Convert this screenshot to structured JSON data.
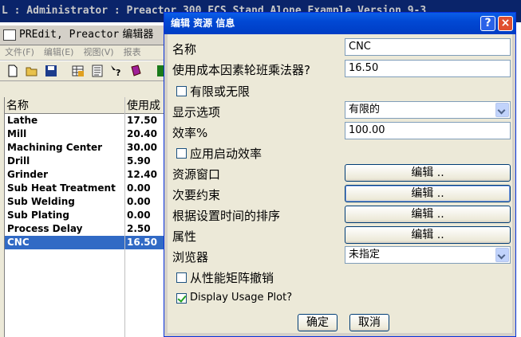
{
  "app_title": "L : Administrator : Preactor 300 FCS Stand Alone Example Version 9-3",
  "child_window": {
    "title_prefix": "PREdit, Preactor",
    "title_suffix": "编辑器"
  },
  "menu": [
    "文件(F)",
    "编辑(E)",
    "视图(V)",
    "报表"
  ],
  "grid": {
    "headers": [
      "名称",
      "使用成"
    ],
    "rows": [
      {
        "name": "Lathe",
        "value": "17.50"
      },
      {
        "name": "Mill",
        "value": "20.40"
      },
      {
        "name": "Machining Center",
        "value": "30.00"
      },
      {
        "name": "Drill",
        "value": "5.90"
      },
      {
        "name": "Grinder",
        "value": "12.40"
      },
      {
        "name": "Sub Heat Treatment",
        "value": "0.00"
      },
      {
        "name": "Sub Welding",
        "value": "0.00"
      },
      {
        "name": "Sub Plating",
        "value": "0.00"
      },
      {
        "name": "Process Delay",
        "value": "2.50"
      },
      {
        "name": "CNC",
        "value": "16.50"
      }
    ],
    "selected_index": 9
  },
  "dialog": {
    "title": "编辑 资源 信息",
    "help": "?",
    "close": "×",
    "name_label": "名称",
    "name_value": "CNC",
    "cost_label": "使用成本因素轮班乘法器?",
    "cost_value": "16.50",
    "finite_label": "有限或无限",
    "finite_checked": false,
    "display_label": "显示选项",
    "display_value": "有限的",
    "efficiency_label": "效率%",
    "efficiency_value": "100.00",
    "startup_label": "应用启动效率",
    "startup_checked": false,
    "resource_window_label": "资源窗口",
    "secondary_label": "次要约束",
    "sequence_label": "根据设置时间的排序",
    "attribute_label": "属性",
    "edit_button": "编辑 ..",
    "browser_label": "浏览器",
    "browser_value": "未指定",
    "matrix_label": "从性能矩阵撤销",
    "matrix_checked": false,
    "usage_plot_label": "Display Usage Plot?",
    "usage_plot_checked": true,
    "ok": "确定",
    "cancel": "取消"
  },
  "colors": {
    "xp_title": "#0148d4",
    "selection": "#316ac5",
    "dialog_face": "#ece9d8"
  }
}
